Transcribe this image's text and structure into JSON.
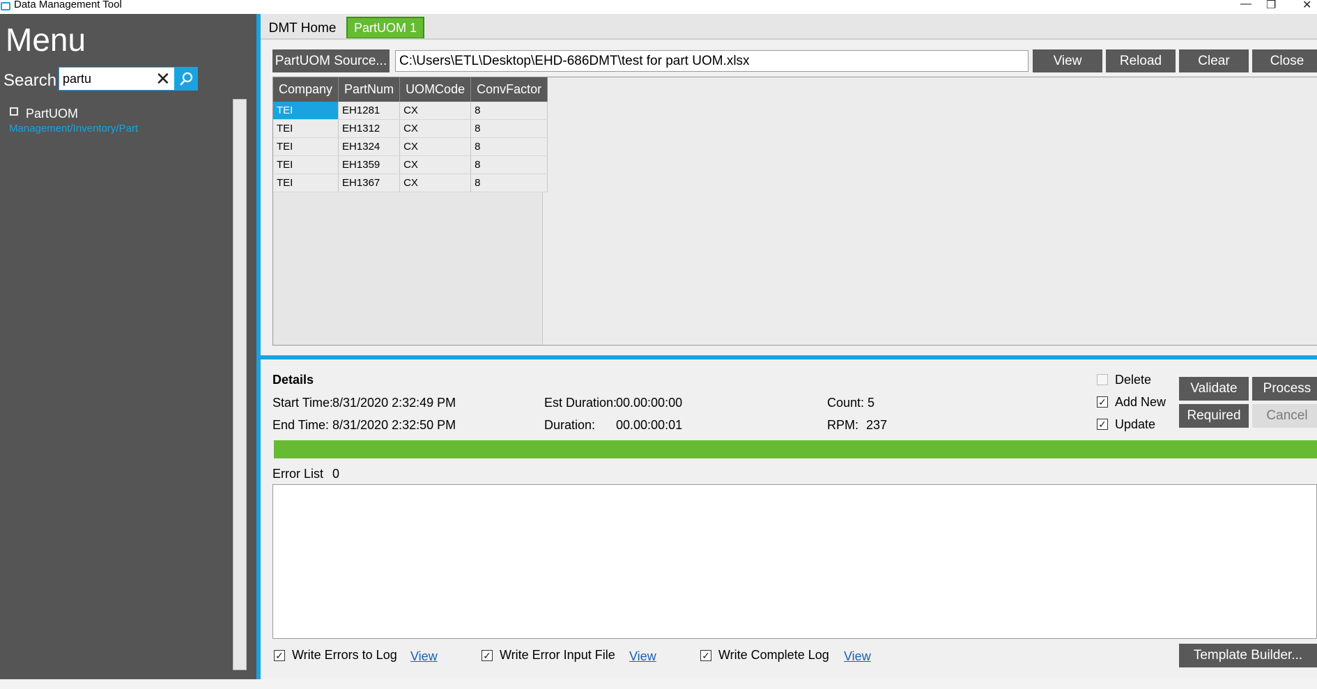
{
  "window": {
    "title": "Data Management Tool",
    "minimize": "—",
    "restore": "❐",
    "close": "✕"
  },
  "sidebar": {
    "menu_title": "Menu",
    "search_label": "Search",
    "search_value": "partu",
    "clear_glyph": "✕",
    "search_glyph": "⚲",
    "result": {
      "title": "PartUOM",
      "path": "Management/Inventory/Part"
    }
  },
  "tabs": [
    {
      "label": "DMT Home"
    },
    {
      "label": "PartUOM 1"
    }
  ],
  "toolbar": {
    "source_button": "PartUOM Source...",
    "file_path": "C:\\Users\\ETL\\Desktop\\EHD-686DMT\\test for part UOM.xlsx",
    "view": "View",
    "reload": "Reload",
    "clear": "Clear",
    "close": "Close"
  },
  "grid": {
    "columns": [
      "Company",
      "PartNum",
      "UOMCode",
      "ConvFactor"
    ],
    "rows": [
      [
        "TEI",
        "EH1281",
        "CX",
        "8"
      ],
      [
        "TEI",
        "EH1312",
        "CX",
        "8"
      ],
      [
        "TEI",
        "EH1324",
        "CX",
        "8"
      ],
      [
        "TEI",
        "EH1359",
        "CX",
        "8"
      ],
      [
        "TEI",
        "EH1367",
        "CX",
        "8"
      ]
    ]
  },
  "details": {
    "title": "Details",
    "start_time_label": "Start Time:",
    "start_time": "8/31/2020 2:32:49 PM",
    "end_time_label": "End Time:",
    "end_time": "8/31/2020 2:32:50 PM",
    "est_duration_label": "Est Duration:",
    "est_duration": "00.00:00:00",
    "duration_label": "Duration:",
    "duration": "00.00:00:01",
    "count_label": "Count:",
    "count": "5",
    "rpm_label": "RPM:",
    "rpm": "237",
    "options": {
      "delete": "Delete",
      "add_new": "Add New",
      "update": "Update"
    },
    "option_states": {
      "delete": false,
      "add_new": true,
      "update": true
    },
    "buttons": {
      "validate": "Validate",
      "process": "Process",
      "required": "Required",
      "cancel": "Cancel"
    },
    "progress": 1.0,
    "progress_color": "#66bb33"
  },
  "errors": {
    "label": "Error List",
    "count": "0"
  },
  "footer": {
    "write_errors": "Write Errors to Log",
    "write_error_input": "Write Error Input File",
    "write_complete": "Write Complete Log",
    "view_link": "View",
    "template_builder": "Template Builder..."
  },
  "colors": {
    "accent": "#1aa3e0",
    "sidebar": "#555555",
    "button": "#595959",
    "tab_active": "#66bb33"
  },
  "check_glyph": "✓"
}
